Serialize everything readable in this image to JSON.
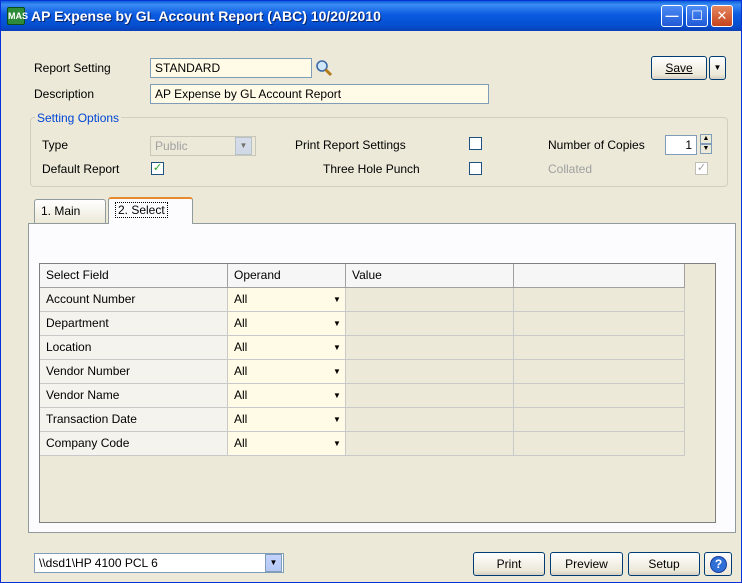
{
  "window": {
    "title": "AP Expense by GL Account Report (ABC) 10/20/2010",
    "app_icon": "MAS",
    "controls": [
      "minimize-icon",
      "maximize-icon",
      "close-icon"
    ]
  },
  "header": {
    "report_setting_label": "Report Setting",
    "report_setting_value": "STANDARD",
    "description_label": "Description",
    "description_value": "AP Expense by GL Account Report",
    "save_label": "Save",
    "save_hotkey": "a"
  },
  "setting_options": {
    "title": "Setting Options",
    "type_label": "Type",
    "type_value": "Public",
    "default_report_label": "Default Report",
    "default_report_checked": true,
    "print_report_settings_label": "Print Report Settings",
    "print_report_settings_checked": false,
    "three_hole_punch_label": "Three Hole Punch",
    "three_hole_punch_checked": false,
    "number_of_copies_label": "Number of Copies",
    "number_of_copies_value": "1",
    "collated_label": "Collated",
    "collated_checked": true
  },
  "tabs": [
    {
      "label": "1. Main",
      "active": false
    },
    {
      "label": "2. Select",
      "active": true
    }
  ],
  "grid": {
    "columns": [
      "Select Field",
      "Operand",
      "Value",
      ""
    ],
    "rows": [
      {
        "field": "Account Number",
        "operand": "All",
        "value": ""
      },
      {
        "field": "Department",
        "operand": "All",
        "value": ""
      },
      {
        "field": "Location",
        "operand": "All",
        "value": ""
      },
      {
        "field": "Vendor Number",
        "operand": "All",
        "value": ""
      },
      {
        "field": "Vendor Name",
        "operand": "All",
        "value": ""
      },
      {
        "field": "Transaction Date",
        "operand": "All",
        "value": ""
      },
      {
        "field": "Company Code",
        "operand": "All",
        "value": ""
      }
    ]
  },
  "footer": {
    "printer": "\\\\dsd1\\HP 4100 PCL 6",
    "print_label": "Print",
    "preview_label": "Preview",
    "setup_label": "Setup",
    "help_glyph": "?"
  },
  "colors": {
    "titlebar": "#0550d0",
    "field_bg": "#fffbe6",
    "group_title": "#0046d5",
    "check": "#21a121"
  }
}
